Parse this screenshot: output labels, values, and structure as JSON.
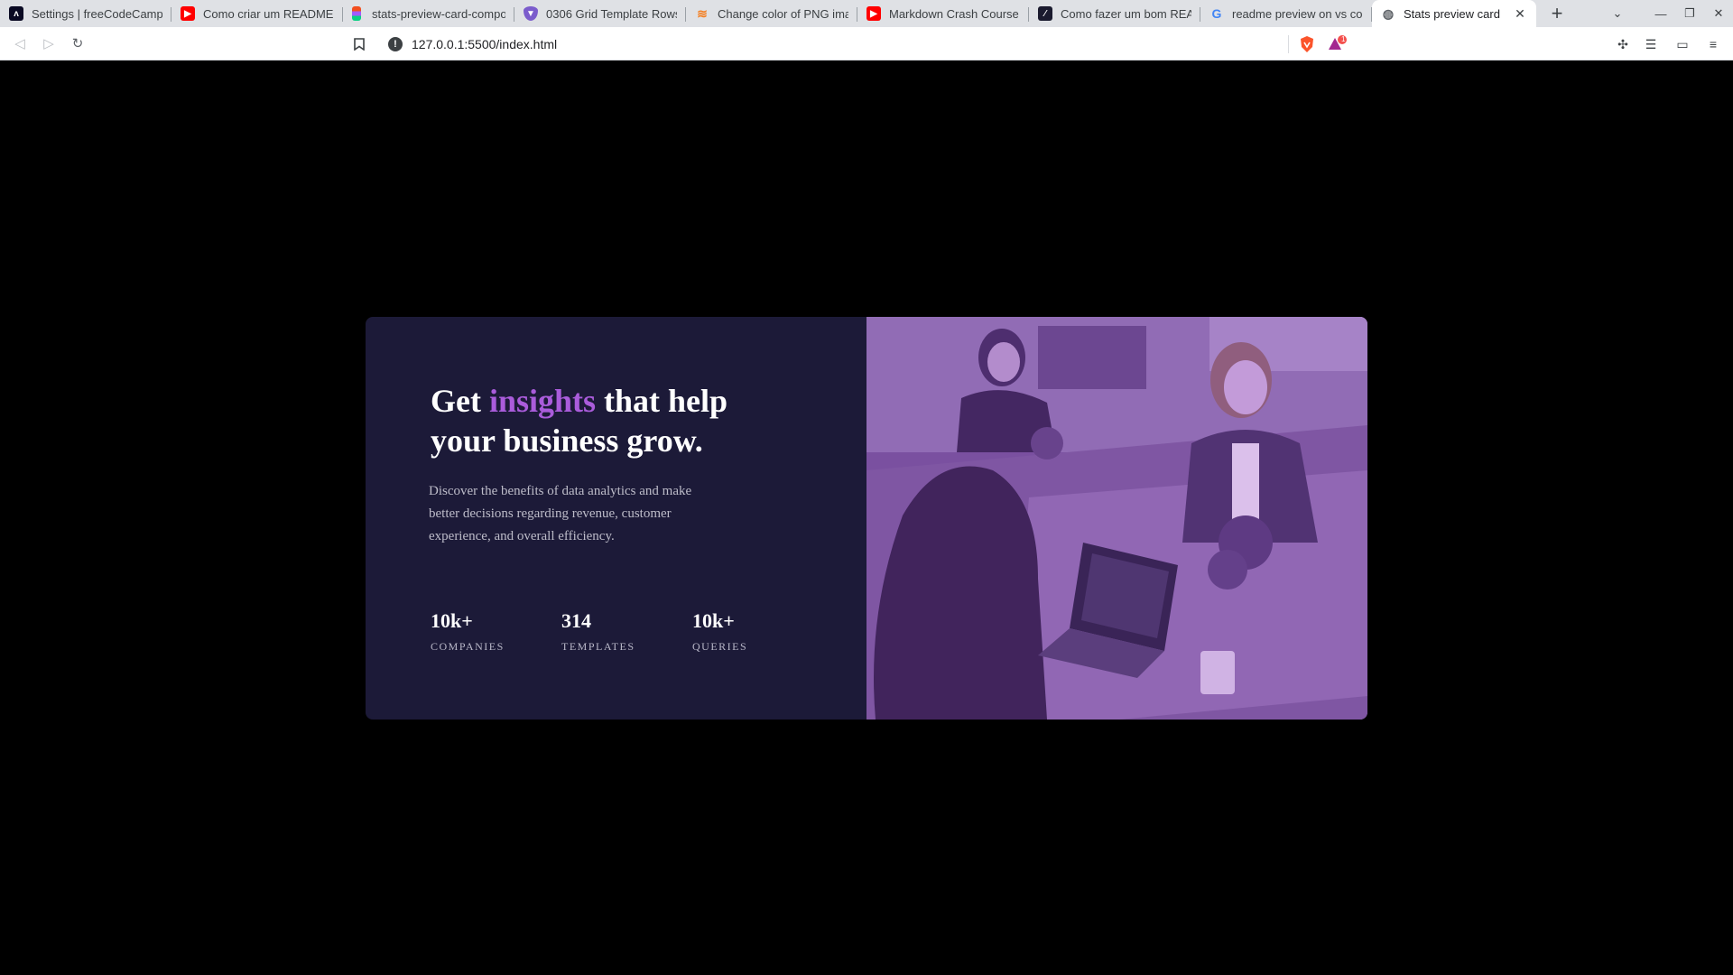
{
  "browser": {
    "tabs": [
      {
        "title": "Settings | freeCodeCamp",
        "icon": "freecodecamp-icon"
      },
      {
        "title": "Como criar um README -",
        "icon": "youtube-icon"
      },
      {
        "title": "stats-preview-card-compo",
        "icon": "figma-icon"
      },
      {
        "title": "0306 Grid Template Rows",
        "icon": "brave-shield-icon"
      },
      {
        "title": "Change color of PNG imag",
        "icon": "stackoverflow-icon"
      },
      {
        "title": "Markdown Crash Course -",
        "icon": "youtube-icon"
      },
      {
        "title": "Como fazer um bom REA",
        "icon": "dev-icon"
      },
      {
        "title": "readme preview on vs co",
        "icon": "google-icon"
      },
      {
        "title": "Stats preview card",
        "icon": "globe-icon"
      }
    ],
    "active_tab": 8,
    "url": "127.0.0.1:5500/index.html",
    "rewards_badge": "1"
  },
  "card": {
    "headline_start": "Get ",
    "headline_accent": "insights",
    "headline_end": " that help your business grow.",
    "description": "Discover the benefits of data analytics and make better decisions regarding revenue, customer experience, and overall efficiency.",
    "stats": [
      {
        "value": "10k+",
        "label": "COMPANIES"
      },
      {
        "value": "314",
        "label": "TEMPLATES"
      },
      {
        "value": "10k+",
        "label": "QUERIES"
      }
    ],
    "image_alt": "people working on laptops"
  },
  "colors": {
    "page_bg": "#000000",
    "card_bg": "#1c1a38",
    "accent": "#aa5cdb",
    "image_tint": "#6a4a8c"
  }
}
